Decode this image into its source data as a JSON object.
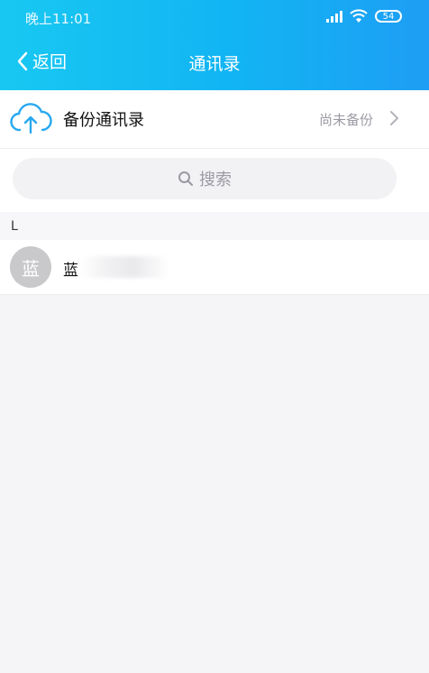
{
  "status_bar": {
    "time": "晚上11:01",
    "battery": "54"
  },
  "nav": {
    "back_label": "返回",
    "title": "通讯录"
  },
  "backup": {
    "label": "备份通讯录",
    "status": "尚未备份"
  },
  "search": {
    "label": "搜索"
  },
  "sections": [
    {
      "letter": "L",
      "contacts": [
        {
          "avatar_text": "蓝",
          "name": "蓝"
        }
      ]
    }
  ],
  "colors": {
    "header_start": "#18c8f2",
    "header_end": "#1e9ef4",
    "background": "#f5f5f8"
  }
}
